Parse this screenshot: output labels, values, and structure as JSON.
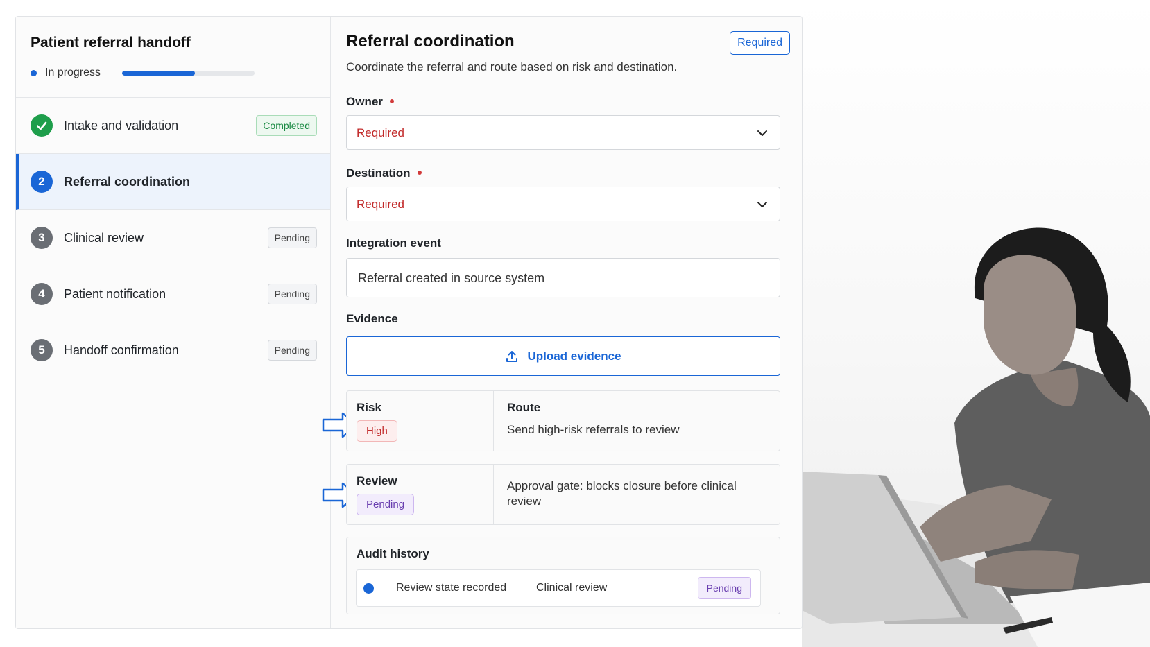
{
  "sidebar": {
    "title": "Patient referral handoff",
    "status": "In progress",
    "progress_fraction": 0.55,
    "steps": [
      {
        "num": "",
        "label": "Intake and validation",
        "badge": "Completed",
        "state": "completed"
      },
      {
        "num": "2",
        "label": "Referral coordination",
        "badge": "",
        "state": "active"
      },
      {
        "num": "3",
        "label": "Clinical review",
        "badge": "Pending",
        "state": "pending"
      },
      {
        "num": "4",
        "label": "Patient notification",
        "badge": "Pending",
        "state": "pending"
      },
      {
        "num": "5",
        "label": "Handoff confirmation",
        "badge": "Pending",
        "state": "pending"
      }
    ]
  },
  "main": {
    "title": "Referral coordination",
    "required_badge": "Required",
    "subtitle": "Coordinate the referral and route based on risk and destination.",
    "owner": {
      "label": "Owner",
      "value": "Required"
    },
    "destination": {
      "label": "Destination",
      "value": "Required"
    },
    "integration": {
      "label": "Integration event",
      "value": "Referral created in source system"
    },
    "evidence": {
      "label": "Evidence",
      "button": "Upload evidence"
    },
    "risk": {
      "label": "Risk",
      "pill": "High",
      "route_title": "Route",
      "route_text": "Send high-risk referrals to review"
    },
    "review": {
      "label": "Review",
      "pill": "Pending",
      "text": "Approval gate: blocks closure before clinical review"
    },
    "audit": {
      "title": "Audit history",
      "event": "Review state recorded",
      "stage": "Clinical review",
      "badge": "Pending"
    }
  },
  "colors": {
    "accent": "#1a66d6",
    "success": "#1e9e4b",
    "error": "#c22b2b",
    "pending_purple": "#6a3fb0"
  }
}
